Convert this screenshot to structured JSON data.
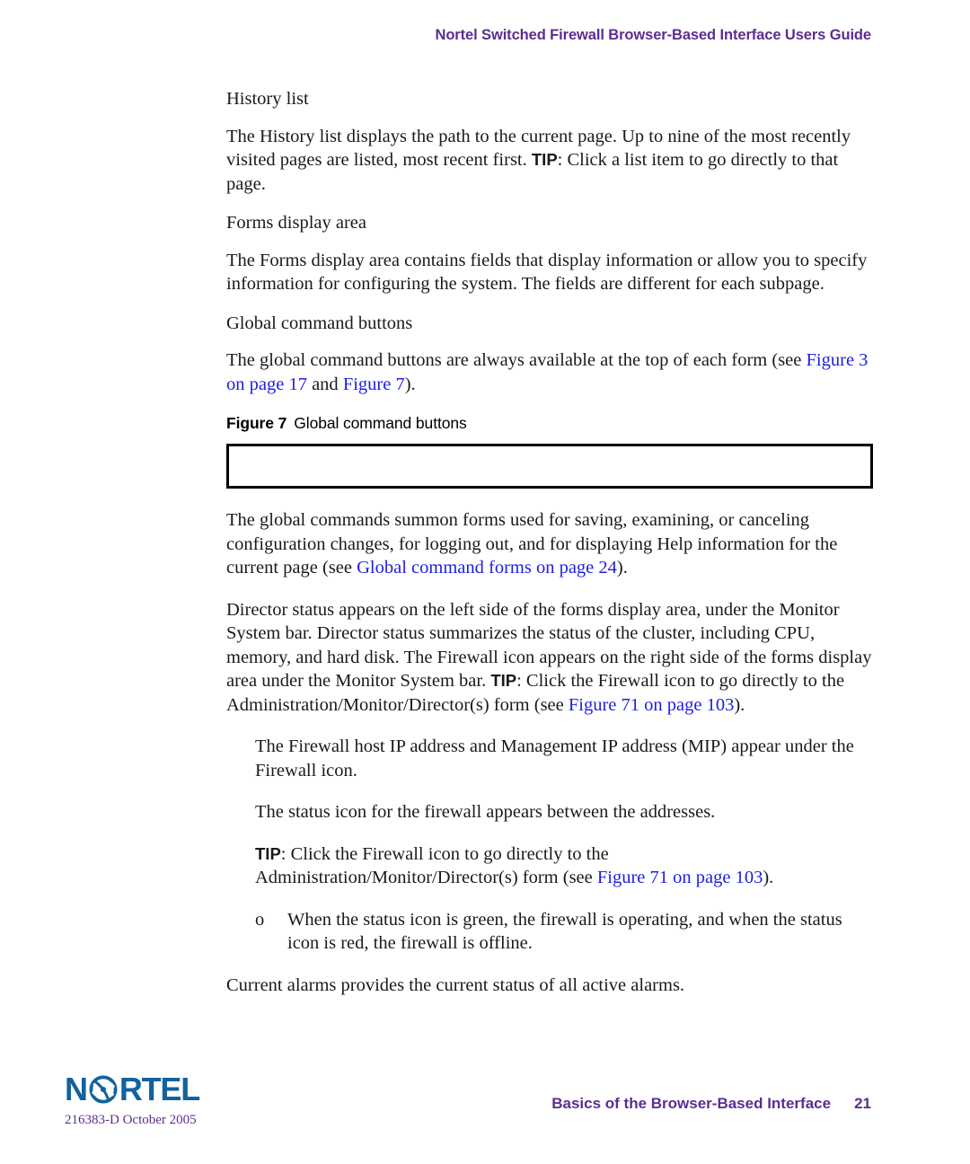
{
  "header": {
    "running_title": "Nortel Switched Firewall Browser-Based Interface Users Guide",
    "color": "#5c2d91"
  },
  "body": {
    "heading_history": "History list",
    "para_history_1": "The History list displays the path to the current page. Up to nine of the most recently visited pages are listed, most recent first. ",
    "para_history_tip": "TIP",
    "para_history_2": ": Click a list item to go directly to that page.",
    "heading_forms": "Forms display area",
    "para_forms": "The Forms display area contains fields that display information or allow you to specify information for configuring the system. The fields are different for each subpage.",
    "heading_global": "Global command buttons",
    "para_global_1": "The global command buttons are always available at the top of each form (see ",
    "link_figure3": "Figure 3 on page 17",
    "para_global_2": " and ",
    "link_figure7": "Figure 7",
    "para_global_3": ").",
    "figure_number": "Figure 7",
    "figure_title": "Global command buttons",
    "para_summon_1": "The global commands summon forms used for saving, examining, or canceling configuration changes, for logging out, and for displaying Help information for the current page (see ",
    "link_global_forms": "Global command forms on page 24",
    "para_summon_2": ").",
    "para_director_1": "Director status appears on the left side of the forms display area, under the Monitor System bar. Director status summarizes the status of the cluster, including CPU, memory, and hard disk. The Firewall icon appears on the right side of the forms display area under the Monitor System bar. ",
    "para_director_tip": "TIP",
    "para_director_2": ": Click the Firewall icon to go directly to the Administration/Monitor/Director(s) form (see ",
    "link_figure71_a": "Figure 71 on page 103",
    "para_director_3": ").",
    "para_ip": "The Firewall host IP address and Management IP address (MIP) appear under the Firewall icon.",
    "para_status_icon": "The status icon for the firewall appears between the addresses.",
    "para_tip2_tip": "TIP",
    "para_tip2_1": ": Click the Firewall icon to go directly to the Administration/Monitor/Director(s) form (see ",
    "link_figure71_b": "Figure 71 on page 103",
    "para_tip2_2": ").",
    "bullet_marker": "o",
    "bullet_text": "When the status icon is green, the firewall is operating, and when the status icon is red, the firewall is offline.",
    "para_alarms": "Current alarms provides the current status of all active alarms.",
    "link_color": "#2020e0"
  },
  "footer": {
    "logo_part_a": "N",
    "logo_part_b": "RTEL",
    "logo_color": "#13629c",
    "doc_number": "216383-D October 2005",
    "section_title": "Basics of the Browser-Based Interface",
    "page_number": "21",
    "color": "#5c2d91"
  }
}
